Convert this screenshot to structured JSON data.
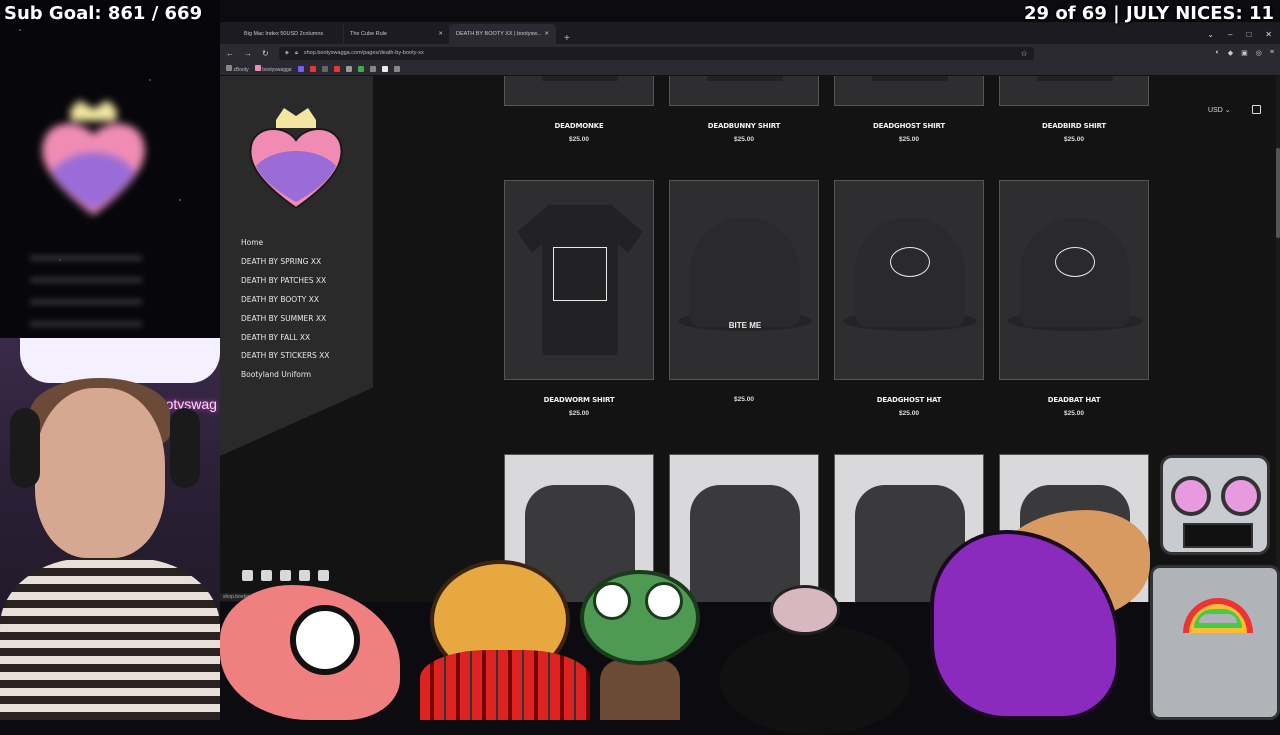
{
  "overlay": {
    "sub_goal": "Sub Goal: 861 / 669",
    "nices": "29 of 69 | JULY NICES: 11",
    "neon_text": "bootyswag"
  },
  "browser": {
    "tabs": [
      {
        "label": "Big Mac Index 50USD 2columns",
        "active": false
      },
      {
        "label": "The Cube Rule",
        "active": false
      },
      {
        "label": "DEATH BY BOOTY XX | bootysw...",
        "active": true
      }
    ],
    "url": "shop.bootyswagga.com/pages/death-by-booty-xx",
    "bookmarks": [
      "zBooty",
      "bootyswagga"
    ]
  },
  "site": {
    "nav": [
      "Home",
      "DEATH BY SPRING XX",
      "DEATH BY PATCHES XX",
      "DEATH BY BOOTY XX",
      "DEATH BY SUMMER XX",
      "DEATH BY FALL XX",
      "DEATH BY STICKERS XX",
      "Bootyland Uniform"
    ],
    "currency": "USD",
    "status_url": "shop.bootys...",
    "products": [
      {
        "name": "DEADMONKE",
        "price": "$25.00",
        "kind": "shirt",
        "light": false
      },
      {
        "name": "DEADBUNNY SHIRT",
        "price": "$25.00",
        "kind": "shirt",
        "light": false
      },
      {
        "name": "DEADGHOST SHIRT",
        "price": "$25.00",
        "kind": "shirt",
        "light": false
      },
      {
        "name": "DEADBIRD SHIRT",
        "price": "$25.00",
        "kind": "shirt",
        "light": false
      },
      {
        "name": "DEADWORM SHIRT",
        "price": "$25.00",
        "kind": "shirt",
        "light": false
      },
      {
        "name": "",
        "price": "$25.00",
        "kind": "hat",
        "light": false,
        "print": "BITE ME"
      },
      {
        "name": "DEADGHOST HAT",
        "price": "$25.00",
        "kind": "hat",
        "light": false
      },
      {
        "name": "DEADBAT HAT",
        "price": "$25.00",
        "kind": "hat",
        "light": false
      },
      {
        "name": "",
        "price": "",
        "kind": "hoodie",
        "light": true
      },
      {
        "name": "",
        "price": "",
        "kind": "hoodie",
        "light": true
      },
      {
        "name": "",
        "price": "",
        "kind": "hoodie",
        "light": true
      },
      {
        "name": "",
        "price": "",
        "kind": "hoodie",
        "light": true
      }
    ]
  },
  "colors": {
    "logo_pink": "#f08cb4",
    "logo_purple": "#9a6cd8",
    "crown": "#f2e6a0"
  }
}
